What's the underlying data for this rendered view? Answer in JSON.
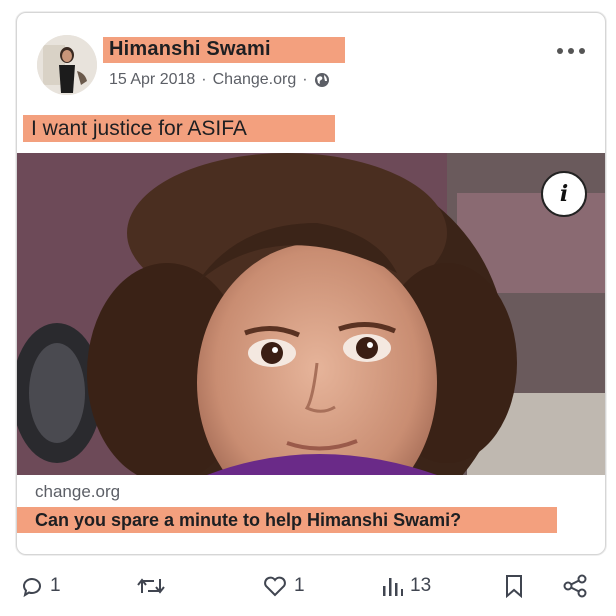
{
  "post": {
    "author": "Himanshi Swami",
    "date": "15 Apr 2018",
    "separator": "·",
    "source": "Change.org",
    "text": "I want justice for ASIFA"
  },
  "link_card": {
    "domain": "change.org",
    "title": "Can you spare a minute to help Himanshi Swami?"
  },
  "info_button": {
    "label": "i"
  },
  "actions": {
    "comments": "1",
    "retweets": "",
    "likes": "1",
    "views": "13"
  },
  "colors": {
    "highlight": "#f3a07e",
    "text": "#1e1f22",
    "muted": "#5c5f66"
  },
  "icons": [
    "globe-icon",
    "more-icon",
    "info-icon",
    "comment-icon",
    "retweet-icon",
    "like-icon",
    "views-icon",
    "bookmark-icon",
    "share-icon"
  ]
}
